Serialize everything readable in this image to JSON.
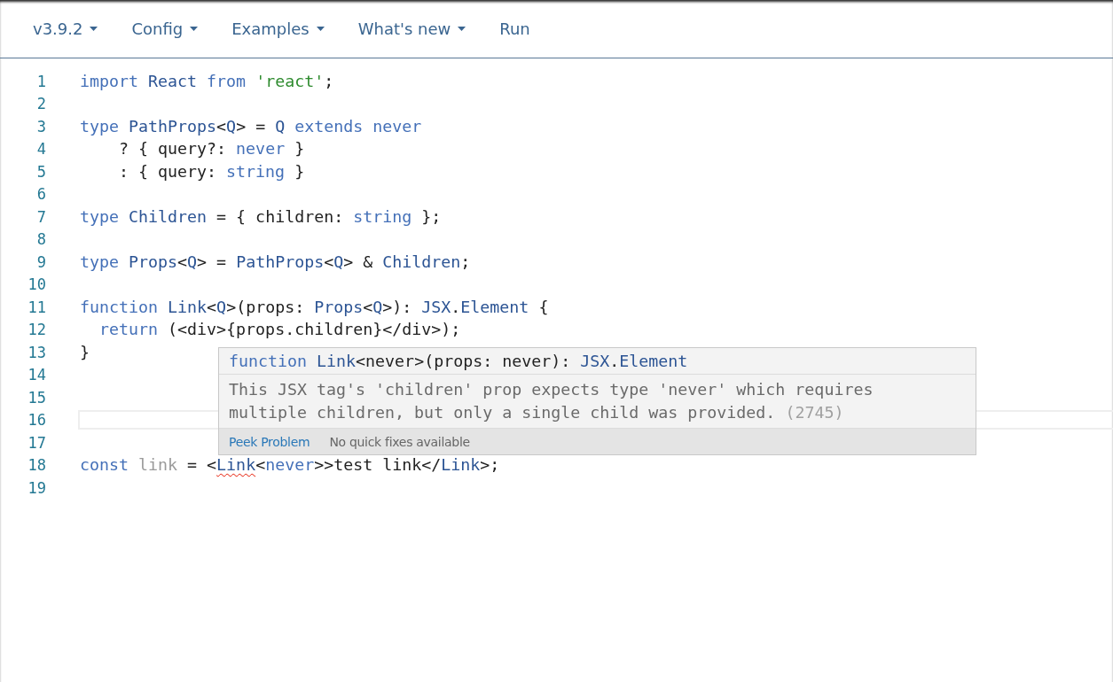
{
  "nav": [
    {
      "label": "v3.9.2",
      "dropdown": true
    },
    {
      "label": "Config",
      "dropdown": true
    },
    {
      "label": "Examples",
      "dropdown": true
    },
    {
      "label": "What's new",
      "dropdown": true
    },
    {
      "label": "Run",
      "dropdown": false
    }
  ],
  "editor": {
    "lines": [
      {
        "number": "1",
        "current": false,
        "tokens": [
          {
            "text": "import ",
            "kind": "keyword"
          },
          {
            "text": "React ",
            "kind": "type"
          },
          {
            "text": "from ",
            "kind": "keyword"
          },
          {
            "text": "'react'",
            "kind": "string"
          },
          {
            "text": ";",
            "kind": "plain"
          }
        ]
      },
      {
        "number": "2",
        "current": false
      },
      {
        "number": "3",
        "current": false,
        "tokens": [
          {
            "text": "type ",
            "kind": "keyword"
          },
          {
            "text": "PathProps",
            "kind": "type"
          },
          {
            "text": "<",
            "kind": "plain"
          },
          {
            "text": "Q",
            "kind": "type"
          },
          {
            "text": "> = ",
            "kind": "plain"
          },
          {
            "text": "Q ",
            "kind": "type"
          },
          {
            "text": "extends never",
            "kind": "keyword"
          }
        ]
      },
      {
        "number": "4",
        "current": false,
        "tokens": [
          {
            "text": "    ? { query?: ",
            "kind": "plain"
          },
          {
            "text": "never",
            "kind": "keyword"
          },
          {
            "text": " }",
            "kind": "plain"
          }
        ]
      },
      {
        "number": "5",
        "current": false,
        "tokens": [
          {
            "text": "    : { query: ",
            "kind": "plain"
          },
          {
            "text": "string",
            "kind": "keyword"
          },
          {
            "text": " }",
            "kind": "plain"
          }
        ]
      },
      {
        "number": "6",
        "current": false
      },
      {
        "number": "7",
        "current": false,
        "tokens": [
          {
            "text": "type ",
            "kind": "keyword"
          },
          {
            "text": "Children",
            "kind": "type"
          },
          {
            "text": " = { children: ",
            "kind": "plain"
          },
          {
            "text": "string",
            "kind": "keyword"
          },
          {
            "text": " };",
            "kind": "plain"
          }
        ]
      },
      {
        "number": "8",
        "current": false
      },
      {
        "number": "9",
        "current": false,
        "tokens": [
          {
            "text": "type ",
            "kind": "keyword"
          },
          {
            "text": "Props",
            "kind": "type"
          },
          {
            "text": "<",
            "kind": "plain"
          },
          {
            "text": "Q",
            "kind": "type"
          },
          {
            "text": "> = ",
            "kind": "plain"
          },
          {
            "text": "PathProps",
            "kind": "type"
          },
          {
            "text": "<",
            "kind": "plain"
          },
          {
            "text": "Q",
            "kind": "type"
          },
          {
            "text": "> & ",
            "kind": "plain"
          },
          {
            "text": "Children",
            "kind": "type"
          },
          {
            "text": ";",
            "kind": "plain"
          }
        ]
      },
      {
        "number": "10",
        "current": false
      },
      {
        "number": "11",
        "current": false,
        "tokens": [
          {
            "text": "function ",
            "kind": "keyword"
          },
          {
            "text": "Link",
            "kind": "type"
          },
          {
            "text": "<",
            "kind": "plain"
          },
          {
            "text": "Q",
            "kind": "type"
          },
          {
            "text": ">(props: ",
            "kind": "plain"
          },
          {
            "text": "Props",
            "kind": "type"
          },
          {
            "text": "<",
            "kind": "plain"
          },
          {
            "text": "Q",
            "kind": "type"
          },
          {
            "text": ">): ",
            "kind": "plain"
          },
          {
            "text": "JSX",
            "kind": "type"
          },
          {
            "text": ".",
            "kind": "plain"
          },
          {
            "text": "Element",
            "kind": "type"
          },
          {
            "text": " {",
            "kind": "plain"
          }
        ]
      },
      {
        "number": "12",
        "current": false,
        "tokens": [
          {
            "text": "  return ",
            "kind": "keyword"
          },
          {
            "text": "(<div>{props.children}</div>);",
            "kind": "plain"
          }
        ]
      },
      {
        "number": "13",
        "current": false,
        "tokens": [
          {
            "text": "}",
            "kind": "plain"
          }
        ]
      },
      {
        "number": "14",
        "current": false
      },
      {
        "number": "15",
        "current": false
      },
      {
        "number": "16",
        "current": true
      },
      {
        "number": "17",
        "current": false
      },
      {
        "number": "18",
        "current": false,
        "tokens": [
          {
            "text": "const ",
            "kind": "keyword"
          },
          {
            "text": "link",
            "kind": "faded"
          },
          {
            "text": " = <",
            "kind": "plain"
          },
          {
            "text": "Link",
            "kind": "error"
          },
          {
            "text": "<",
            "kind": "plain"
          },
          {
            "text": "never",
            "kind": "keyword"
          },
          {
            "text": ">>test link</",
            "kind": "plain"
          },
          {
            "text": "Link",
            "kind": "type"
          },
          {
            "text": ">;",
            "kind": "plain"
          }
        ]
      },
      {
        "number": "19",
        "current": false
      }
    ]
  },
  "hover": {
    "signature": [
      {
        "text": "function ",
        "kind": "keyword"
      },
      {
        "text": "Link",
        "kind": "type"
      },
      {
        "text": "<never>(props: never): ",
        "kind": "plain"
      },
      {
        "text": "JSX",
        "kind": "type"
      },
      {
        "text": ".",
        "kind": "plain"
      },
      {
        "text": "Element",
        "kind": "type"
      }
    ],
    "message_lines": [
      "This JSX tag's 'children' prop expects type 'never' which requires",
      "multiple children, but only a single child was provided."
    ],
    "error_code": "(2745)",
    "action": "Peek Problem",
    "note": "No quick fixes available"
  }
}
